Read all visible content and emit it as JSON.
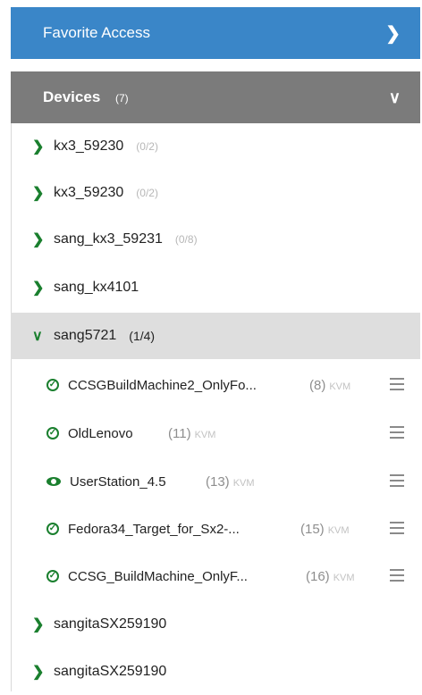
{
  "favorite": {
    "label": "Favorite Access",
    "chevron_icon": "chevron-right-icon"
  },
  "devices": {
    "label": "Devices",
    "count": "(7)",
    "chevron_icon": "chevron-down-icon",
    "items": [
      {
        "name": "kx3_59230",
        "count": "(0/2)",
        "expanded": false
      },
      {
        "name": "kx3_59230",
        "count": "(0/2)",
        "expanded": false
      },
      {
        "name": "sang_kx3_59231",
        "count": "(0/8)",
        "expanded": false
      },
      {
        "name": "sang_kx4101",
        "count": "",
        "expanded": false
      },
      {
        "name": "sang5721",
        "count": "(1/4)",
        "expanded": true
      }
    ],
    "targets": [
      {
        "name": "CCSGBuildMachine2_OnlyFo...",
        "count": "(8)",
        "kvm": "KVM",
        "icon": "check-circle-icon"
      },
      {
        "name": "OldLenovo",
        "count": "(11)",
        "kvm": "KVM",
        "icon": "check-circle-icon"
      },
      {
        "name": "UserStation_4.5",
        "count": "(13)",
        "kvm": "KVM",
        "icon": "eye-icon"
      },
      {
        "name": "Fedora34_Target_for_Sx2-...",
        "count": "(15)",
        "kvm": "KVM",
        "icon": "check-circle-icon"
      },
      {
        "name": "CCSG_BuildMachine_OnlyF...",
        "count": "(16)",
        "kvm": "KVM",
        "icon": "check-circle-icon"
      }
    ],
    "more_items": [
      {
        "name": "sangitaSX259190"
      },
      {
        "name": "sangitaSX259190"
      }
    ]
  },
  "colors": {
    "favorite_bg": "#3a86c8",
    "devices_bg": "#7b7b7b",
    "accent_green": "#1a7f2e"
  }
}
